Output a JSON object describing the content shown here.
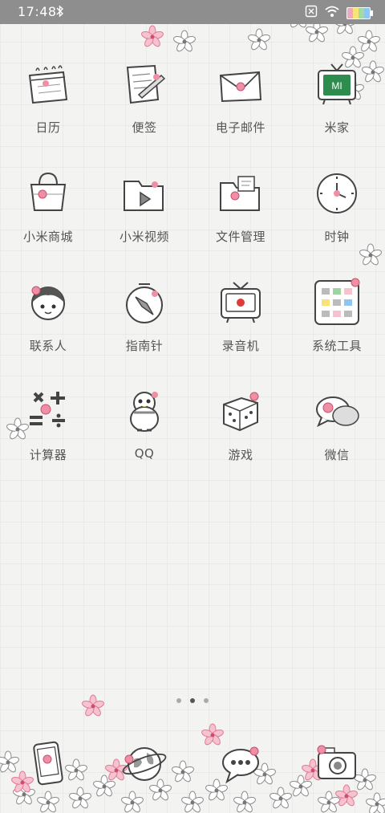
{
  "status_bar": {
    "time": "17:48",
    "bluetooth_icon": "bluetooth-icon",
    "icons": [
      "close-box-icon",
      "wifi-icon",
      "battery-icon"
    ]
  },
  "apps": [
    {
      "label": "日历",
      "icon": "calendar-icon"
    },
    {
      "label": "便签",
      "icon": "notes-icon"
    },
    {
      "label": "电子邮件",
      "icon": "mail-icon"
    },
    {
      "label": "米家",
      "icon": "mijia-tv-icon"
    },
    {
      "label": "小米商城",
      "icon": "shopping-bag-icon"
    },
    {
      "label": "小米视频",
      "icon": "video-folder-icon"
    },
    {
      "label": "文件管理",
      "icon": "file-folder-icon"
    },
    {
      "label": "时钟",
      "icon": "clock-icon"
    },
    {
      "label": "联系人",
      "icon": "contacts-girl-icon"
    },
    {
      "label": "指南针",
      "icon": "compass-icon"
    },
    {
      "label": "录音机",
      "icon": "recorder-tv-icon"
    },
    {
      "label": "系统工具",
      "icon": "system-tools-icon"
    },
    {
      "label": "计算器",
      "icon": "calculator-icon"
    },
    {
      "label": "QQ",
      "icon": "qq-penguin-icon"
    },
    {
      "label": "游戏",
      "icon": "dice-icon"
    },
    {
      "label": "微信",
      "icon": "wechat-bubble-icon"
    }
  ],
  "dock": [
    {
      "icon": "phone-icon"
    },
    {
      "icon": "browser-globe-icon"
    },
    {
      "icon": "messages-bubble-icon"
    },
    {
      "icon": "camera-icon"
    }
  ],
  "page_indicator": {
    "pages": 3,
    "current_page": 2
  },
  "colors": {
    "accent_flower": "#ee8fa5",
    "line": "#444444",
    "status_bar": "#8e8e8e"
  }
}
